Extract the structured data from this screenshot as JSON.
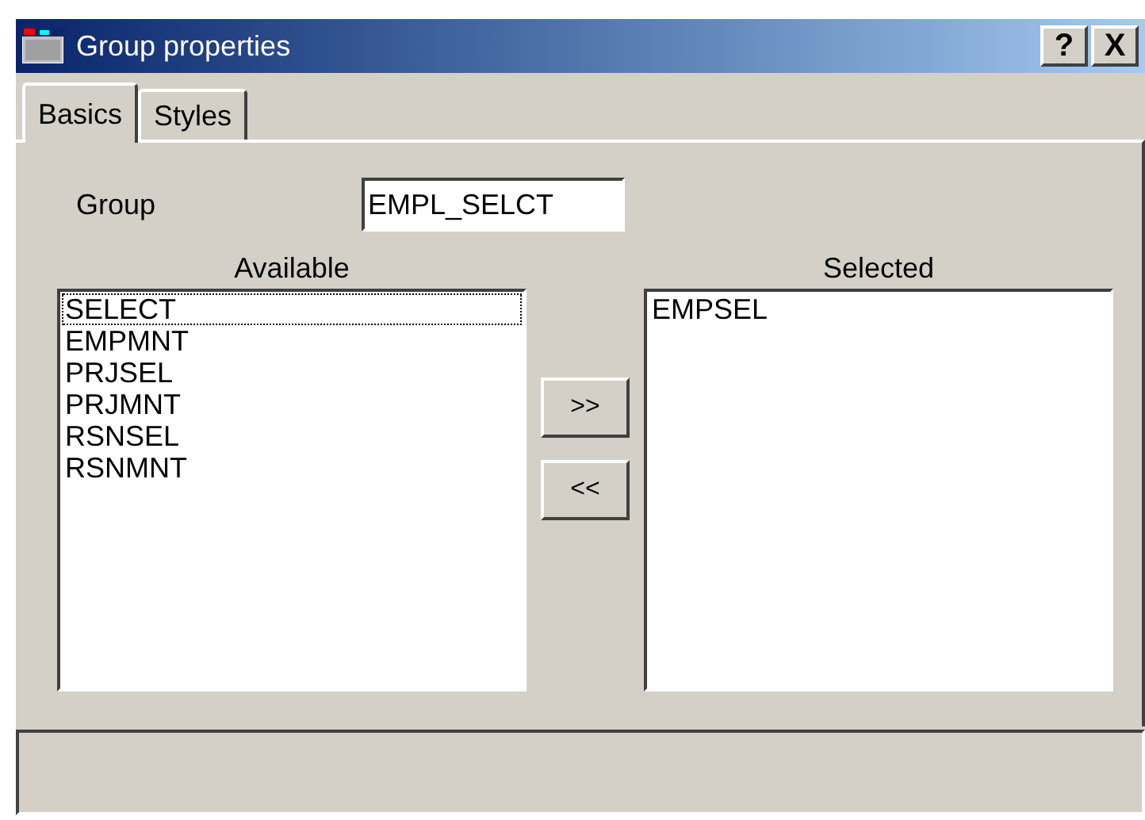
{
  "window": {
    "title": "Group properties",
    "controls": [
      "?",
      "X"
    ]
  },
  "tabs": [
    {
      "label": "Basics",
      "selected": true
    },
    {
      "label": "Styles",
      "selected": false
    }
  ],
  "group_field": {
    "label": "Group",
    "value": "EMPL_SELCT"
  },
  "available": {
    "label": "Available",
    "items": [
      {
        "text": "SELECT",
        "focused": true
      },
      {
        "text": "EMPMNT",
        "focused": false
      },
      {
        "text": "PRJSEL",
        "focused": false
      },
      {
        "text": "PRJMNT",
        "focused": false
      },
      {
        "text": "RSNSEL",
        "focused": false
      },
      {
        "text": "RSNMNT",
        "focused": false
      }
    ]
  },
  "move_buttons": [
    ">>",
    "<<"
  ],
  "selected": {
    "label": "Selected",
    "items": [
      {
        "text": "EMPSEL",
        "focused": false
      }
    ]
  }
}
